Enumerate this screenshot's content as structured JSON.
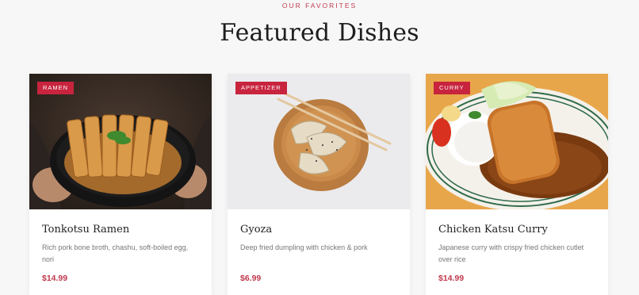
{
  "section": {
    "eyebrow": "OUR FAVORITES",
    "title": "Featured Dishes"
  },
  "colors": {
    "accent": "#c8243e",
    "price": "#c0394d",
    "background": "#f7f7f7"
  },
  "dishes": [
    {
      "badge": "RAMEN",
      "title": "Tonkotsu Ramen",
      "description": "Rich pork bone broth, chashu, soft-boiled egg, nori",
      "price": "$14.99",
      "image": "ramen-photo"
    },
    {
      "badge": "APPETIZER",
      "title": "Gyoza",
      "description": "Deep fried dumpling with chicken & pork",
      "price": "$6.99",
      "image": "gyoza-photo"
    },
    {
      "badge": "CURRY",
      "title": "Chicken Katsu Curry",
      "description": "Japanese curry with crispy fried chicken cutlet over rice",
      "price": "$14.99",
      "image": "katsu-curry-photo"
    }
  ]
}
